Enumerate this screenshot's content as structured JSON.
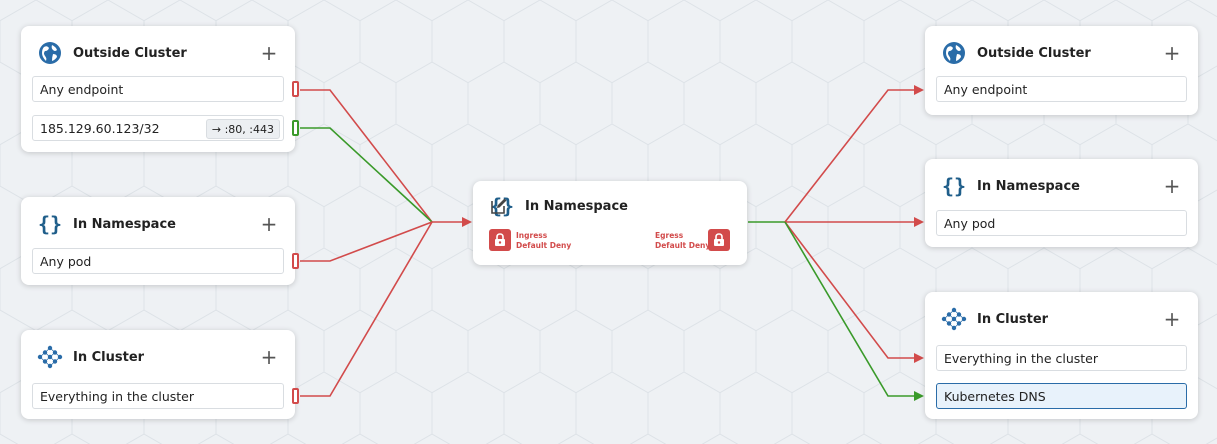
{
  "colors": {
    "deny": "#d24b4b",
    "allow": "#3a9a2a",
    "namespace_icon": "#1f5e8a",
    "cluster_icon": "#2a6ca8",
    "globe_icon": "#2a6ca8"
  },
  "ingress": {
    "outside_cluster": {
      "icon": "globe-icon",
      "title": "Outside Cluster",
      "rows": [
        {
          "label": "Any endpoint",
          "status": "deny"
        },
        {
          "label": "185.129.60.123/32",
          "ports": "→ :80, :443",
          "status": "allow"
        }
      ]
    },
    "in_namespace": {
      "icon": "braces-icon",
      "title": "In Namespace",
      "rows": [
        {
          "label": "Any pod",
          "status": "deny"
        }
      ]
    },
    "in_cluster": {
      "icon": "cluster-icon",
      "title": "In Cluster",
      "rows": [
        {
          "label": "Everything in the cluster",
          "status": "deny"
        }
      ]
    }
  },
  "center": {
    "icon": "braces-icon",
    "title": "In Namespace",
    "ingress_label_1": "Ingress",
    "ingress_label_2": "Default Deny",
    "egress_label_1": "Egress",
    "egress_label_2": "Default Deny"
  },
  "egress": {
    "outside_cluster": {
      "icon": "globe-icon",
      "title": "Outside Cluster",
      "rows": [
        {
          "label": "Any endpoint",
          "status": "deny"
        }
      ]
    },
    "in_namespace": {
      "icon": "braces-icon",
      "title": "In Namespace",
      "rows": [
        {
          "label": "Any pod",
          "status": "deny"
        }
      ]
    },
    "in_cluster": {
      "icon": "cluster-icon",
      "title": "In Cluster",
      "rows": [
        {
          "label": "Everything in the cluster",
          "status": "deny"
        },
        {
          "label": "Kubernetes DNS",
          "status": "allow",
          "selected": true
        }
      ]
    }
  }
}
